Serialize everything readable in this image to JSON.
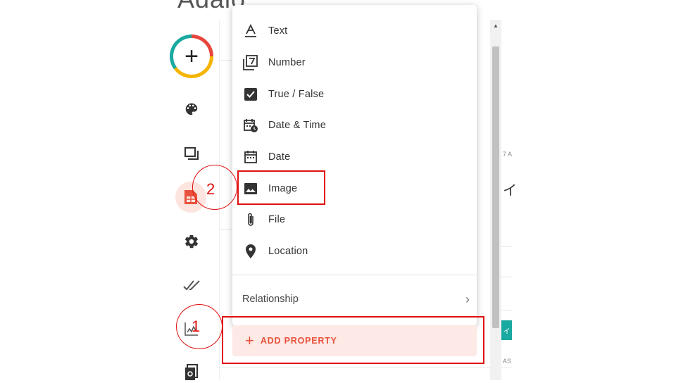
{
  "page": {
    "title_fragment": "Adalo"
  },
  "sidebar": {
    "icons": [
      "add-icon",
      "palette-icon",
      "screens-icon",
      "database-icon",
      "gear-icon",
      "double-check-icon",
      "analytics-icon",
      "publish-icon"
    ],
    "add_symbol": "+",
    "active_item": "database-icon"
  },
  "menu": {
    "items": [
      {
        "label": "Text",
        "icon": "text-icon"
      },
      {
        "label": "Number",
        "icon": "number-icon",
        "glyph": "7"
      },
      {
        "label": "True / False",
        "icon": "checkbox-icon"
      },
      {
        "label": "Date & Time",
        "icon": "date-time-icon"
      },
      {
        "label": "Date",
        "icon": "calendar-icon"
      },
      {
        "label": "Image",
        "icon": "image-icon"
      },
      {
        "label": "File",
        "icon": "paperclip-icon"
      },
      {
        "label": "Location",
        "icon": "location-pin-icon"
      }
    ],
    "relationship_label": "Relationship",
    "relationship_chevron": "›"
  },
  "add_property": {
    "symbol": "+",
    "label": "ADD PROPERTY"
  },
  "background": {
    "right_fragment_1": "7 A",
    "right_fragment_2": "イ",
    "right_fragment_3": "イ",
    "right_fragment_4": "AS"
  },
  "annotations": {
    "label_1": "1",
    "label_2": "2"
  },
  "colors": {
    "accent": "#e8513c",
    "highlight": "#e01010",
    "menu_bg": "#ffffff",
    "add_property_bg": "#fde9e5"
  }
}
